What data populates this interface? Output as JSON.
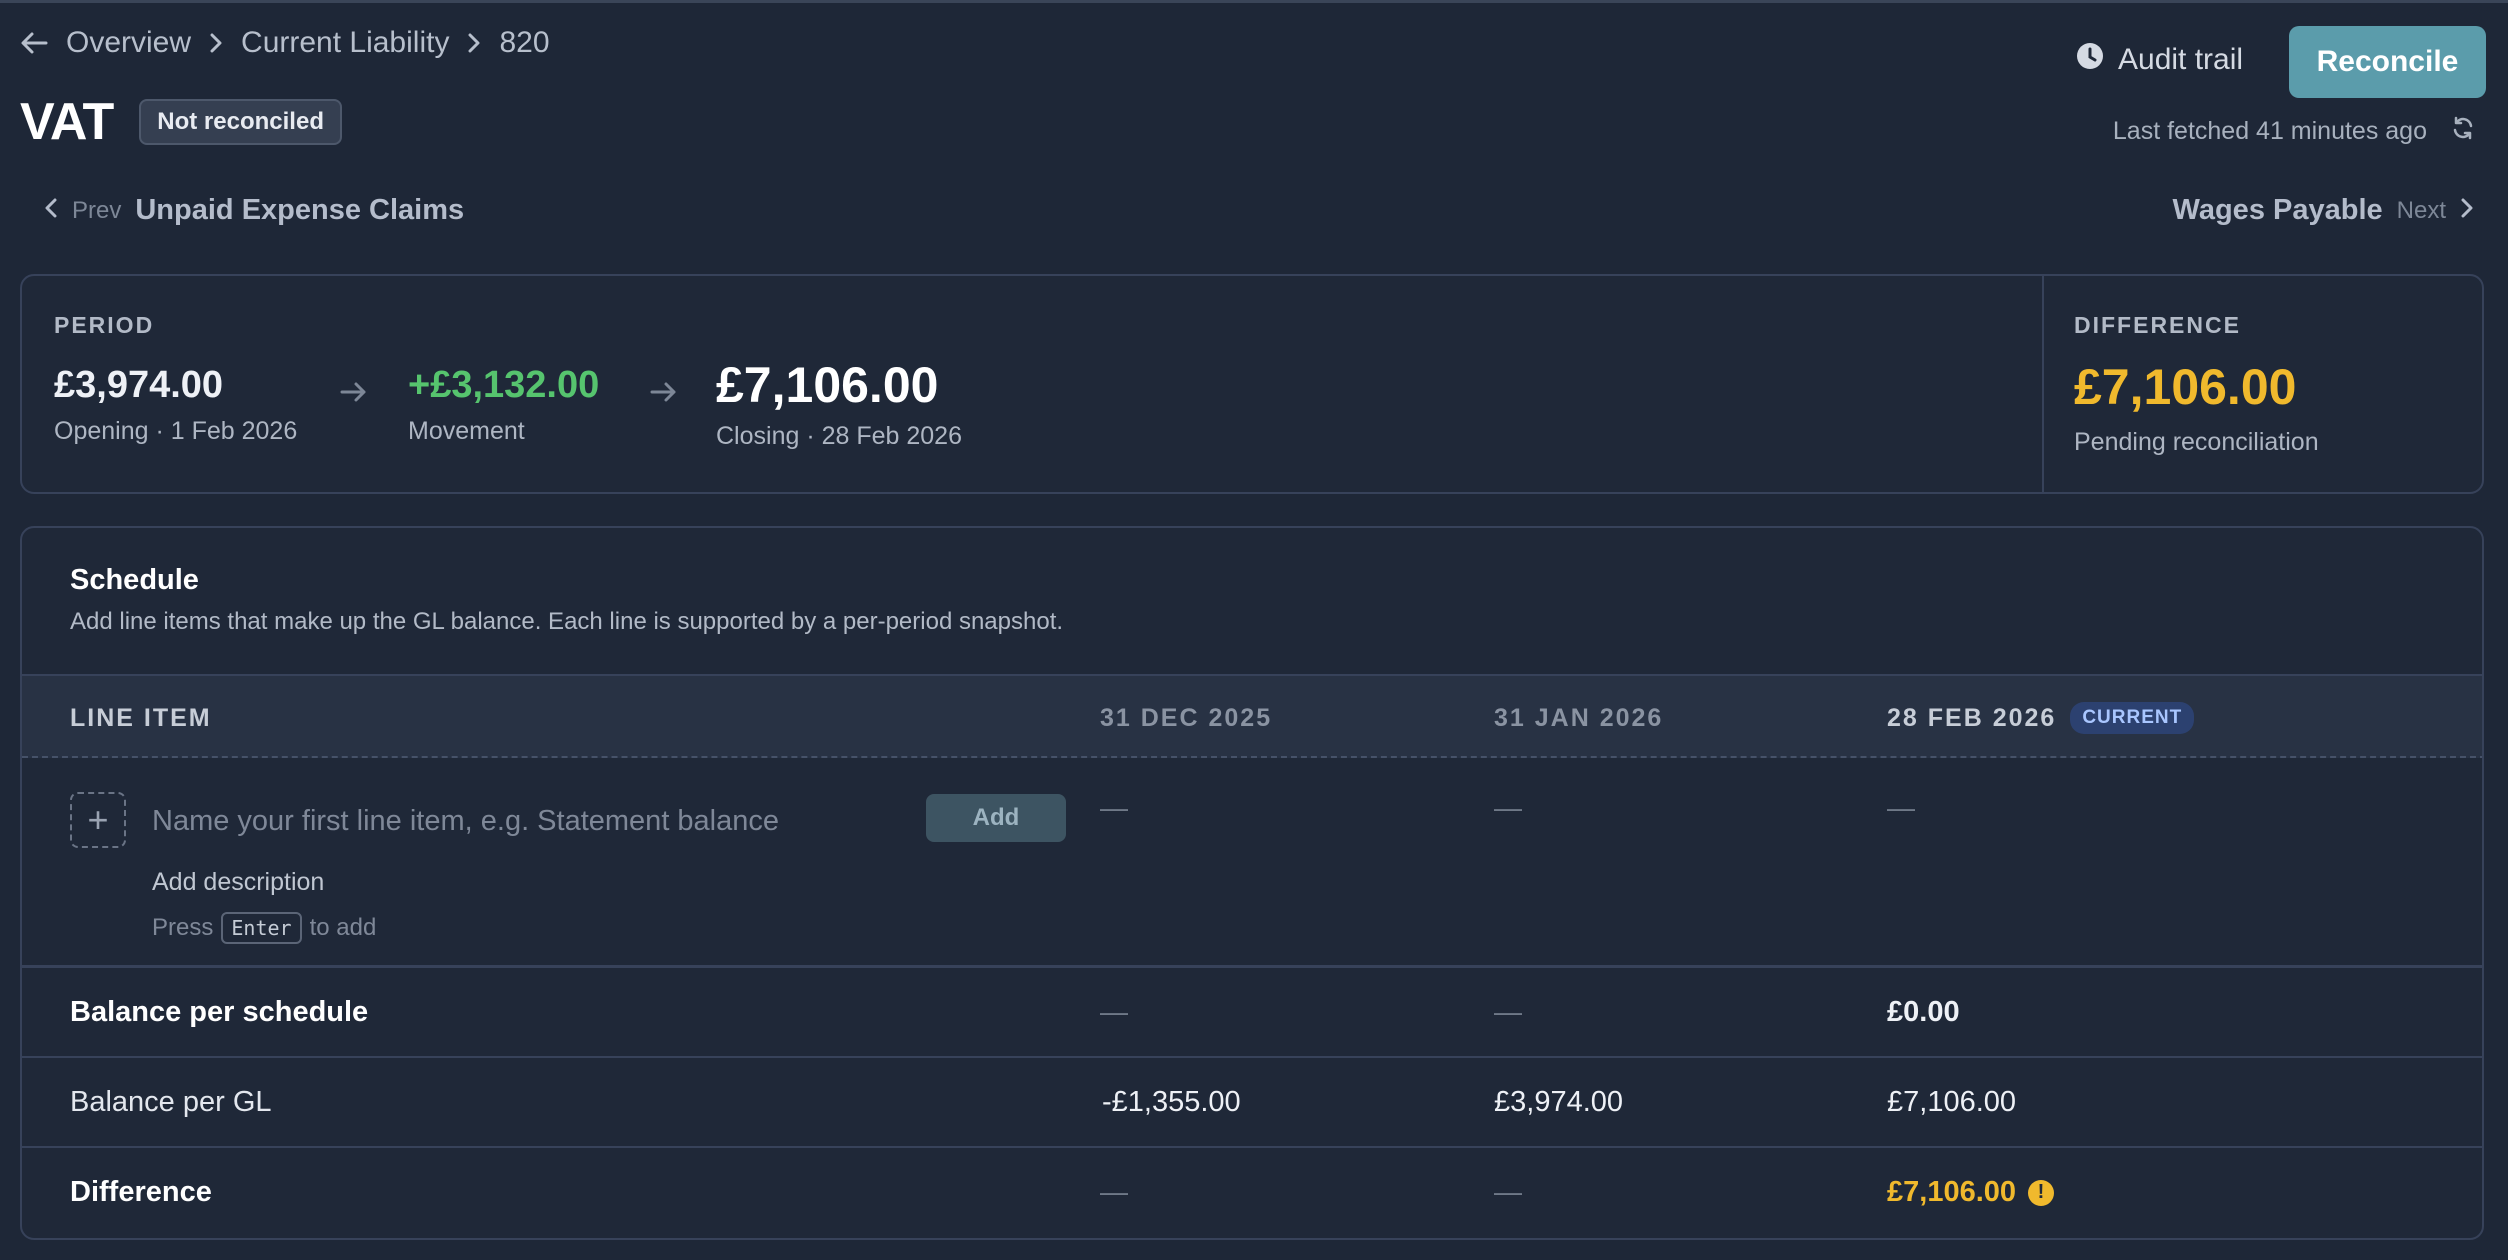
{
  "breadcrumb": {
    "items": [
      "Overview",
      "Current Liability",
      "820"
    ]
  },
  "page": {
    "title": "VAT",
    "status": "Not reconciled"
  },
  "header": {
    "audit_trail_label": "Audit trail",
    "reconcile_label": "Reconcile",
    "last_fetched": "Last fetched 41 minutes ago"
  },
  "nav": {
    "prev_label": "Prev",
    "prev_account": "Unpaid Expense Claims",
    "next_label": "Next",
    "next_account": "Wages Payable"
  },
  "period": {
    "label": "PERIOD",
    "opening_value": "£3,974.00",
    "opening_caption": "Opening · 1 Feb 2026",
    "movement_value": "+£3,132.00",
    "movement_caption": "Movement",
    "closing_value": "£7,106.00",
    "closing_caption": "Closing · 28 Feb 2026"
  },
  "difference": {
    "label": "DIFFERENCE",
    "value": "£7,106.00",
    "caption": "Pending reconciliation"
  },
  "schedule": {
    "title": "Schedule",
    "description": "Add line items that make up the GL balance. Each line is supported by a per-period snapshot.",
    "columns": [
      "LINE ITEM",
      "31 DEC 2025",
      "31 JAN 2026",
      "28 FEB 2026"
    ],
    "current_badge": "CURRENT",
    "entry": {
      "placeholder": "Name your first line item, e.g. Statement balance",
      "add_label": "Add",
      "add_description": "Add description",
      "hint_pre": "Press",
      "hint_key": "Enter",
      "hint_post": "to add",
      "cells": [
        "—",
        "—",
        "—"
      ]
    },
    "rows": [
      {
        "label": "Balance per schedule",
        "values": [
          "—",
          "—",
          "£0.00"
        ]
      },
      {
        "label": "Balance per GL",
        "values": [
          "-£1,355.00",
          "£3,974.00",
          "£7,106.00"
        ]
      },
      {
        "label": "Difference",
        "values": [
          "—",
          "—",
          "£7,106.00"
        ]
      }
    ]
  },
  "colors": {
    "background": "#1e2737",
    "accent": "#5b9cab",
    "positive": "#56c46e",
    "warning": "#f0b92d"
  }
}
